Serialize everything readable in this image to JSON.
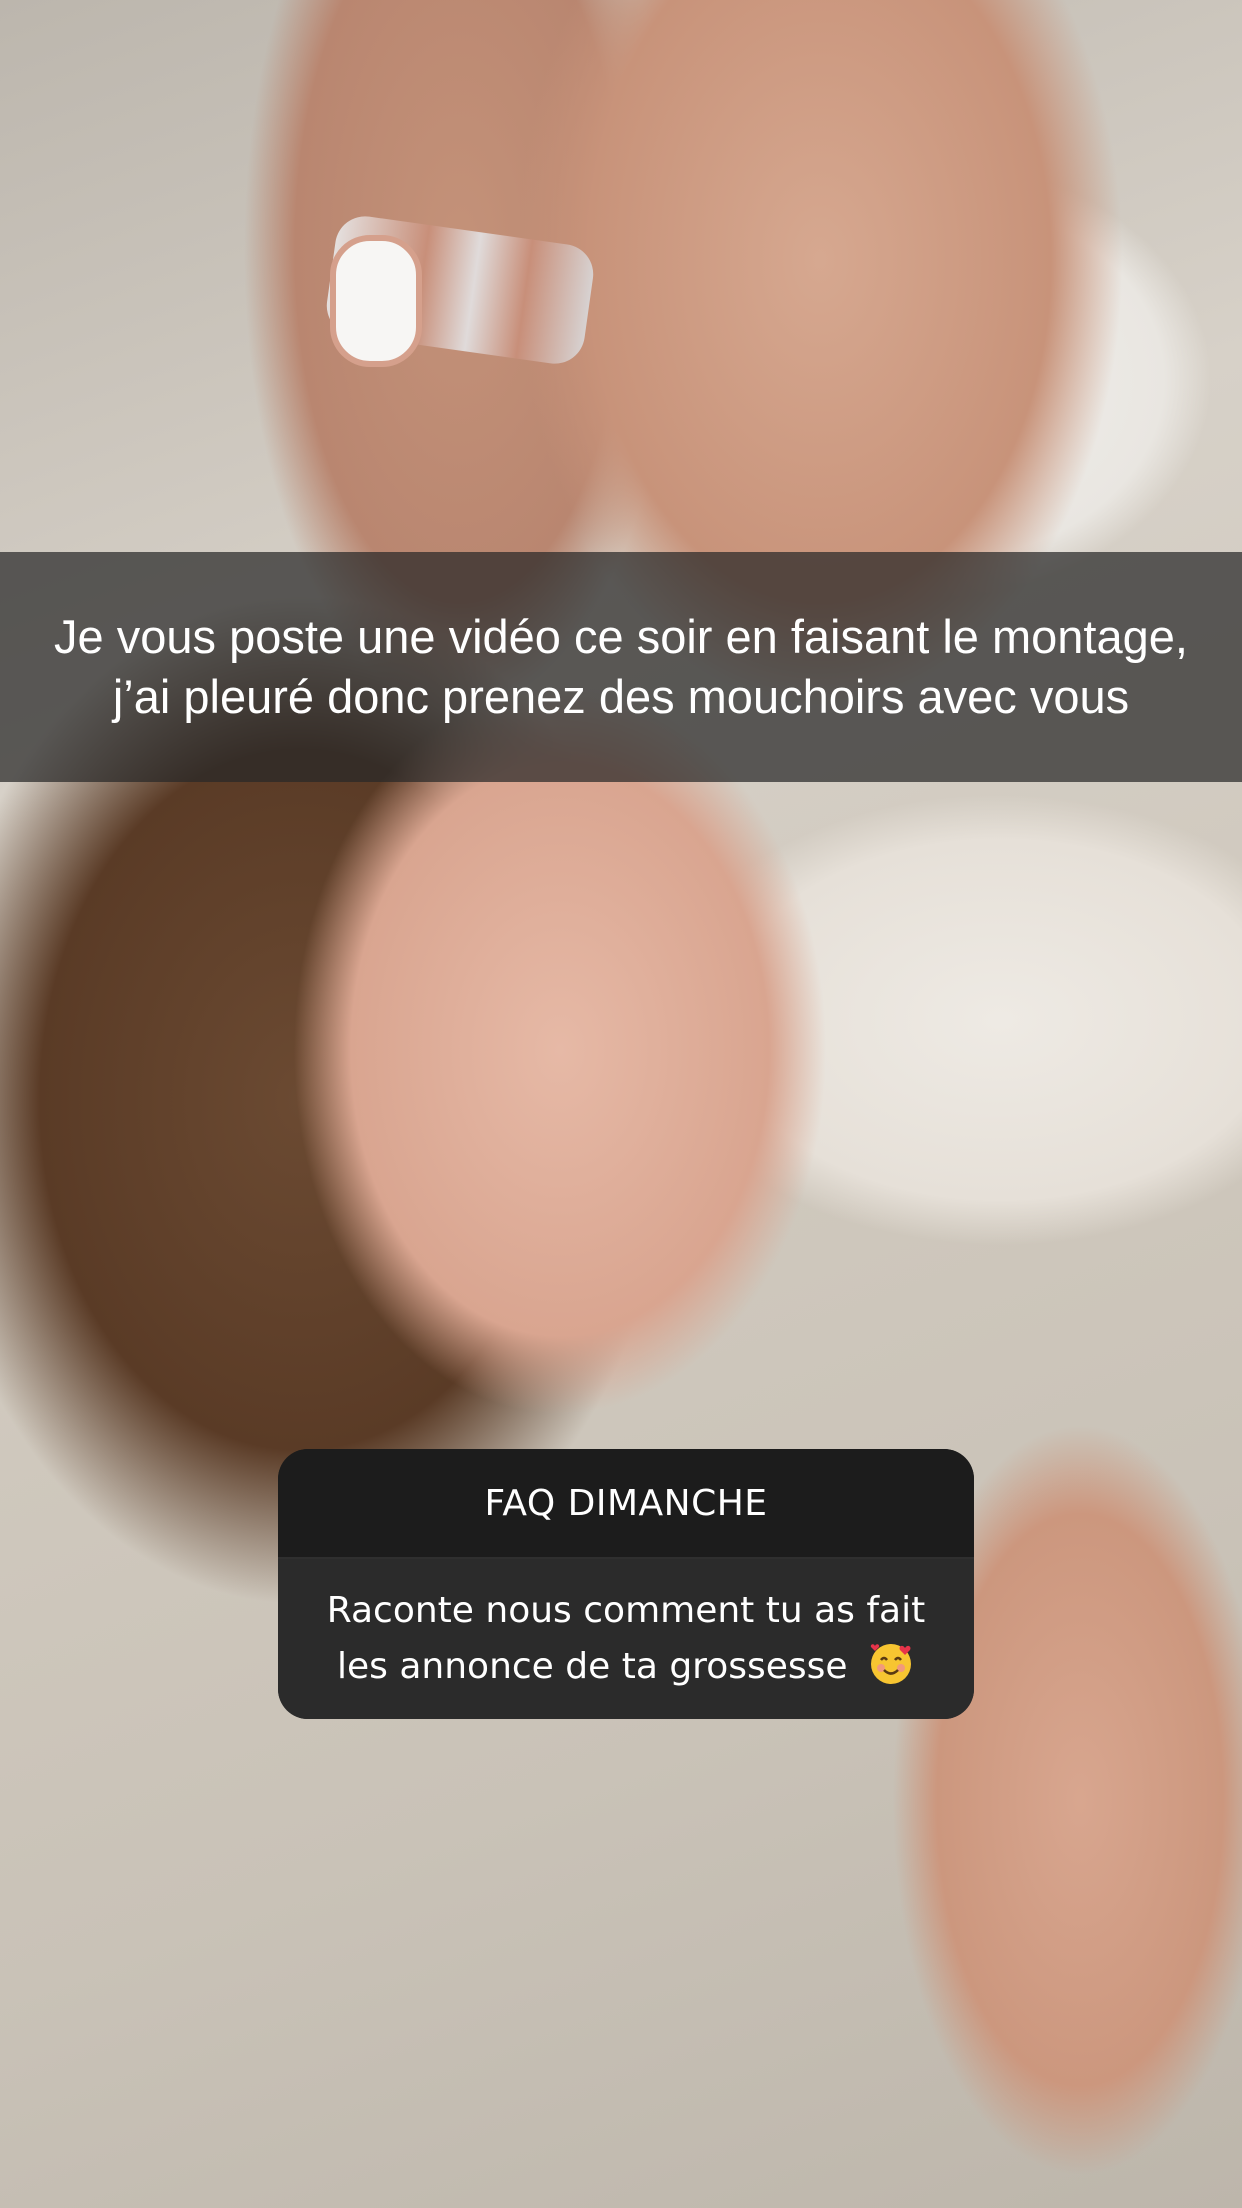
{
  "story": {
    "caption": "Je vous poste une vidéo ce soir en faisant le montage, j’ai pleuré donc prenez des mouchoirs avec vous"
  },
  "faq_card": {
    "title": "FAQ DIMANCHE",
    "question_line1": "Raconte nous comment tu as fait",
    "question_line2": "les annonce de ta grossesse",
    "emoji": "smiling-face-with-hearts-icon",
    "colors": {
      "header_bg": "#1c1c1c",
      "body_bg": "#2b2b2b",
      "text": "#ffffff"
    }
  },
  "caption_bar_color": "rgba(40,40,40,0.72)"
}
